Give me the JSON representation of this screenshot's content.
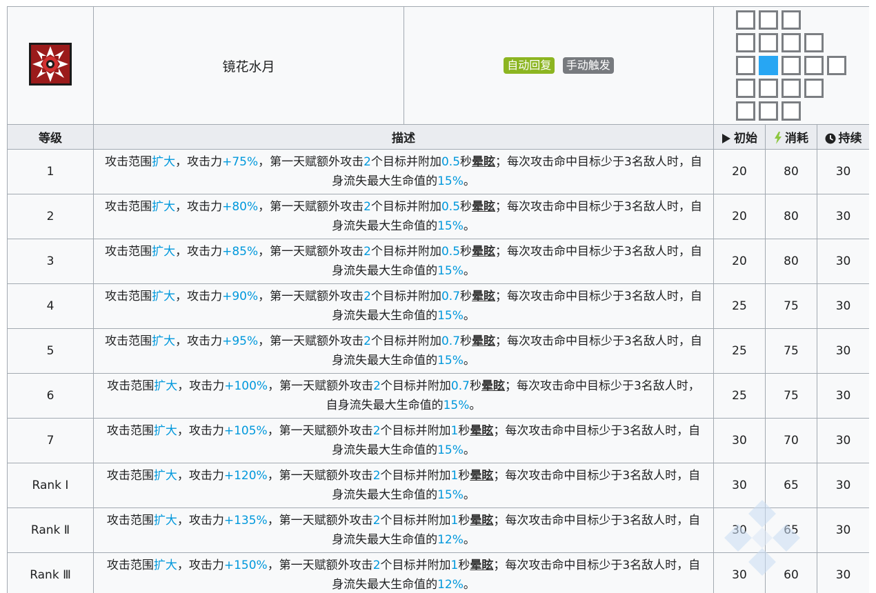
{
  "skill": {
    "name": "镜花水月",
    "icon": "skill-icon",
    "tags": [
      {
        "label": "自动回复",
        "color": "#8cb521"
      },
      {
        "label": "手动触发",
        "color": "#777a7e"
      }
    ]
  },
  "range_grid": {
    "cells": [
      [
        0,
        0
      ],
      [
        0,
        1
      ],
      [
        0,
        2
      ],
      [
        1,
        0
      ],
      [
        1,
        1
      ],
      [
        1,
        2
      ],
      [
        1,
        3
      ],
      [
        2,
        0
      ],
      [
        2,
        1
      ],
      [
        2,
        2
      ],
      [
        2,
        3
      ],
      [
        2,
        4
      ],
      [
        3,
        0
      ],
      [
        3,
        1
      ],
      [
        3,
        2
      ],
      [
        3,
        3
      ],
      [
        4,
        0
      ],
      [
        4,
        1
      ],
      [
        4,
        2
      ]
    ],
    "self": [
      2,
      1
    ],
    "self_color": "#27a6f3"
  },
  "header": {
    "level": "等级",
    "description": "描述",
    "initial": "初始",
    "cost": "消耗",
    "duration": "持续",
    "initial_icon": "play-icon",
    "cost_icon": "lightning-icon",
    "duration_icon": "clock-icon"
  },
  "levels": [
    {
      "level": "1",
      "range": "扩大",
      "atk": "+75%",
      "targets": "2",
      "stun": "0.5",
      "hp": "15%",
      "initial": "20",
      "cost": "80",
      "duration": "30"
    },
    {
      "level": "2",
      "range": "扩大",
      "atk": "+80%",
      "targets": "2",
      "stun": "0.5",
      "hp": "15%",
      "initial": "20",
      "cost": "80",
      "duration": "30"
    },
    {
      "level": "3",
      "range": "扩大",
      "atk": "+85%",
      "targets": "2",
      "stun": "0.5",
      "hp": "15%",
      "initial": "20",
      "cost": "80",
      "duration": "30"
    },
    {
      "level": "4",
      "range": "扩大",
      "atk": "+90%",
      "targets": "2",
      "stun": "0.7",
      "hp": "15%",
      "initial": "25",
      "cost": "75",
      "duration": "30"
    },
    {
      "level": "5",
      "range": "扩大",
      "atk": "+95%",
      "targets": "2",
      "stun": "0.7",
      "hp": "15%",
      "initial": "25",
      "cost": "75",
      "duration": "30"
    },
    {
      "level": "6",
      "range": "扩大",
      "atk": "+100%",
      "targets": "2",
      "stun": "0.7",
      "hp": "15%",
      "initial": "25",
      "cost": "75",
      "duration": "30",
      "alt_wrap": true
    },
    {
      "level": "7",
      "range": "扩大",
      "atk": "+105%",
      "targets": "2",
      "stun": "1",
      "hp": "15%",
      "initial": "30",
      "cost": "70",
      "duration": "30"
    },
    {
      "level": "Rank Ⅰ",
      "range": "扩大",
      "atk": "+120%",
      "targets": "2",
      "stun": "1",
      "hp": "15%",
      "initial": "30",
      "cost": "65",
      "duration": "30"
    },
    {
      "level": "Rank Ⅱ",
      "range": "扩大",
      "atk": "+135%",
      "targets": "2",
      "stun": "1",
      "hp": "12%",
      "initial": "30",
      "cost": "65",
      "duration": "30"
    },
    {
      "level": "Rank Ⅲ",
      "range": "扩大",
      "atk": "+150%",
      "targets": "2",
      "stun": "1",
      "hp": "12%",
      "initial": "30",
      "cost": "60",
      "duration": "30"
    }
  ],
  "desc_text": {
    "p1": "攻击范围",
    "p2": "，攻击力",
    "p3": "，第一天赋额外攻击",
    "p4": "个目标并附加",
    "p5": "秒",
    "stun_term": "晕眩",
    "p6": "；每次攻击命中目标少于3名敌人时，自",
    "p6_alt": "；每次攻击命中目标少于3名敌人时，",
    "p7": "身流失最大生命值的",
    "p7_alt": "自身流失最大生命值的",
    "p8": "。"
  },
  "colors": {
    "highlight": "#0098dc",
    "border": "#a2a9b1",
    "header_bg": "#eaecf0",
    "cell_bg": "#f8f9fa"
  }
}
